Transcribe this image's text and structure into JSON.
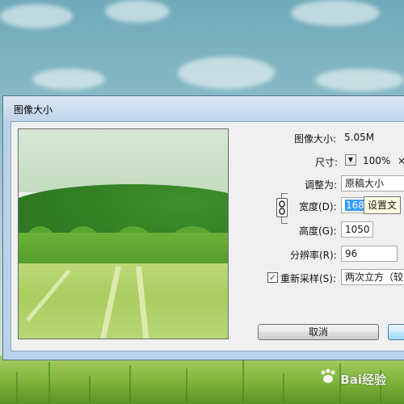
{
  "dialog": {
    "title": "图像大小",
    "image_size_label": "图像大小:",
    "image_size_value": "5.05M",
    "dimensions_label": "尺寸:",
    "dimensions_value": "100%",
    "dimensions_sep": "×",
    "fit_to_label": "调整为:",
    "fit_to_value": "原稿大小",
    "width_label": "宽度(D):",
    "width_value": "1680",
    "height_label": "高度(G):",
    "height_value": "1050",
    "resolution_label": "分辨率(R):",
    "resolution_value": "96",
    "resample_label": "重新采样(S):",
    "resample_checked": true,
    "resample_value": "两次立方（较",
    "tooltip": "设置文",
    "cancel_label": "取消"
  },
  "desktop": {
    "watermark": "Bai经验"
  }
}
